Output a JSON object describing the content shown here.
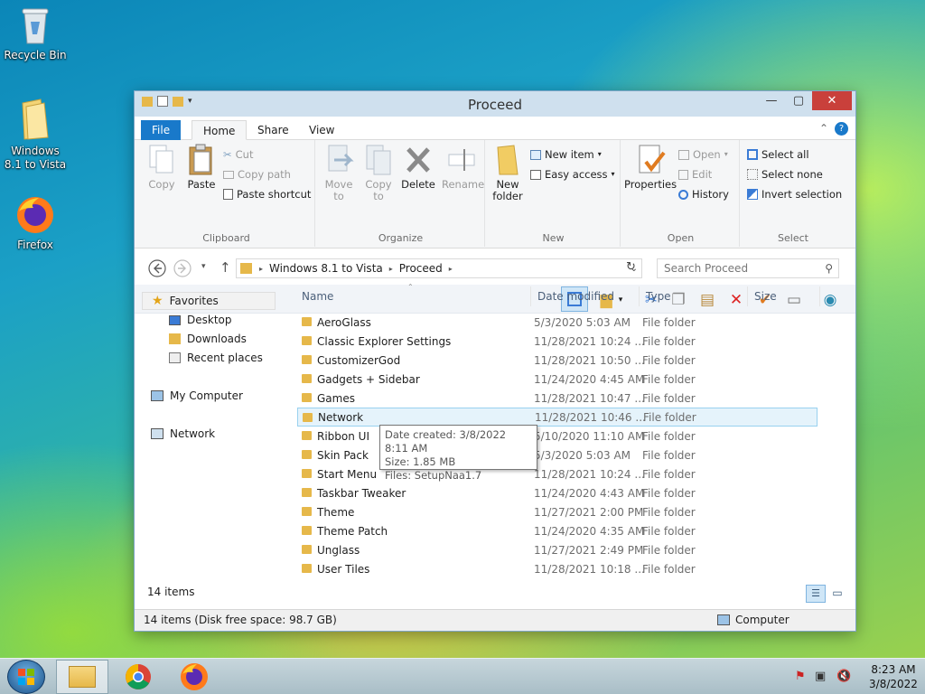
{
  "desktop": {
    "icons": [
      {
        "label": "Recycle Bin"
      },
      {
        "label": "Windows 8.1 to Vista"
      },
      {
        "label": "Firefox"
      }
    ]
  },
  "window": {
    "title": "Proceed",
    "tabs": {
      "file": "File",
      "home": "Home",
      "share": "Share",
      "view": "View"
    },
    "ribbon": {
      "clipboard": {
        "copy": "Copy",
        "paste": "Paste",
        "cut": "Cut",
        "copy_path": "Copy path",
        "paste_shortcut": "Paste shortcut",
        "label": "Clipboard"
      },
      "organize": {
        "move_to": "Move to",
        "copy_to": "Copy to",
        "delete": "Delete",
        "rename": "Rename",
        "label": "Organize"
      },
      "new": {
        "new_folder": "New folder",
        "new_item": "New item",
        "easy_access": "Easy access",
        "label": "New"
      },
      "open": {
        "properties": "Properties",
        "open": "Open",
        "edit": "Edit",
        "history": "History",
        "label": "Open"
      },
      "select": {
        "select_all": "Select all",
        "select_none": "Select none",
        "invert": "Invert selection",
        "label": "Select"
      }
    },
    "address": {
      "crumbs": [
        "Windows 8.1 to Vista",
        "Proceed"
      ],
      "search_placeholder": "Search Proceed"
    },
    "nav": {
      "favorites": "Favorites",
      "desktop": "Desktop",
      "downloads": "Downloads",
      "recent": "Recent places",
      "computer": "My Computer",
      "network": "Network"
    },
    "columns": {
      "name": "Name",
      "date": "Date modified",
      "type": "Type",
      "size": "Size"
    },
    "files": [
      {
        "name": "AeroGlass",
        "date": "5/3/2020 5:03 AM",
        "type": "File folder"
      },
      {
        "name": "Classic Explorer Settings",
        "date": "11/28/2021 10:24 ...",
        "type": "File folder"
      },
      {
        "name": "CustomizerGod",
        "date": "11/28/2021 10:50 ...",
        "type": "File folder"
      },
      {
        "name": "Gadgets + Sidebar",
        "date": "11/24/2020 4:45 AM",
        "type": "File folder"
      },
      {
        "name": "Games",
        "date": "11/28/2021 10:47 ...",
        "type": "File folder"
      },
      {
        "name": "Network",
        "date": "11/28/2021 10:46 ...",
        "type": "File folder"
      },
      {
        "name": "Ribbon UI",
        "date": "5/10/2020 11:10 AM",
        "type": "File folder"
      },
      {
        "name": "Skin Pack",
        "date": "5/3/2020 5:03 AM",
        "type": "File folder"
      },
      {
        "name": "Start Menu",
        "date": "11/28/2021 10:24 ...",
        "type": "File folder"
      },
      {
        "name": "Taskbar Tweaker",
        "date": "11/24/2020 4:43 AM",
        "type": "File folder"
      },
      {
        "name": "Theme",
        "date": "11/27/2021 2:00 PM",
        "type": "File folder"
      },
      {
        "name": "Theme Patch",
        "date": "11/24/2020 4:35 AM",
        "type": "File folder"
      },
      {
        "name": "Unglass",
        "date": "11/27/2021 2:49 PM",
        "type": "File folder"
      },
      {
        "name": "User Tiles",
        "date": "11/28/2021 10:18 ...",
        "type": "File folder"
      }
    ],
    "tooltip": {
      "line1": "Date created: 3/8/2022 8:11 AM",
      "line2": "Size: 1.85 MB",
      "line3": "Files: SetupNaa1.7"
    },
    "item_count": "14 items",
    "status_left": "14 items (Disk free space: 98.7 GB)",
    "status_right": "Computer"
  },
  "taskbar": {
    "time": "8:23 AM",
    "date": "3/8/2022"
  },
  "colors": {
    "accent": "#1979ca",
    "close": "#c9403b",
    "selection": "#e5f3fb",
    "folder": "#e6b84a"
  }
}
